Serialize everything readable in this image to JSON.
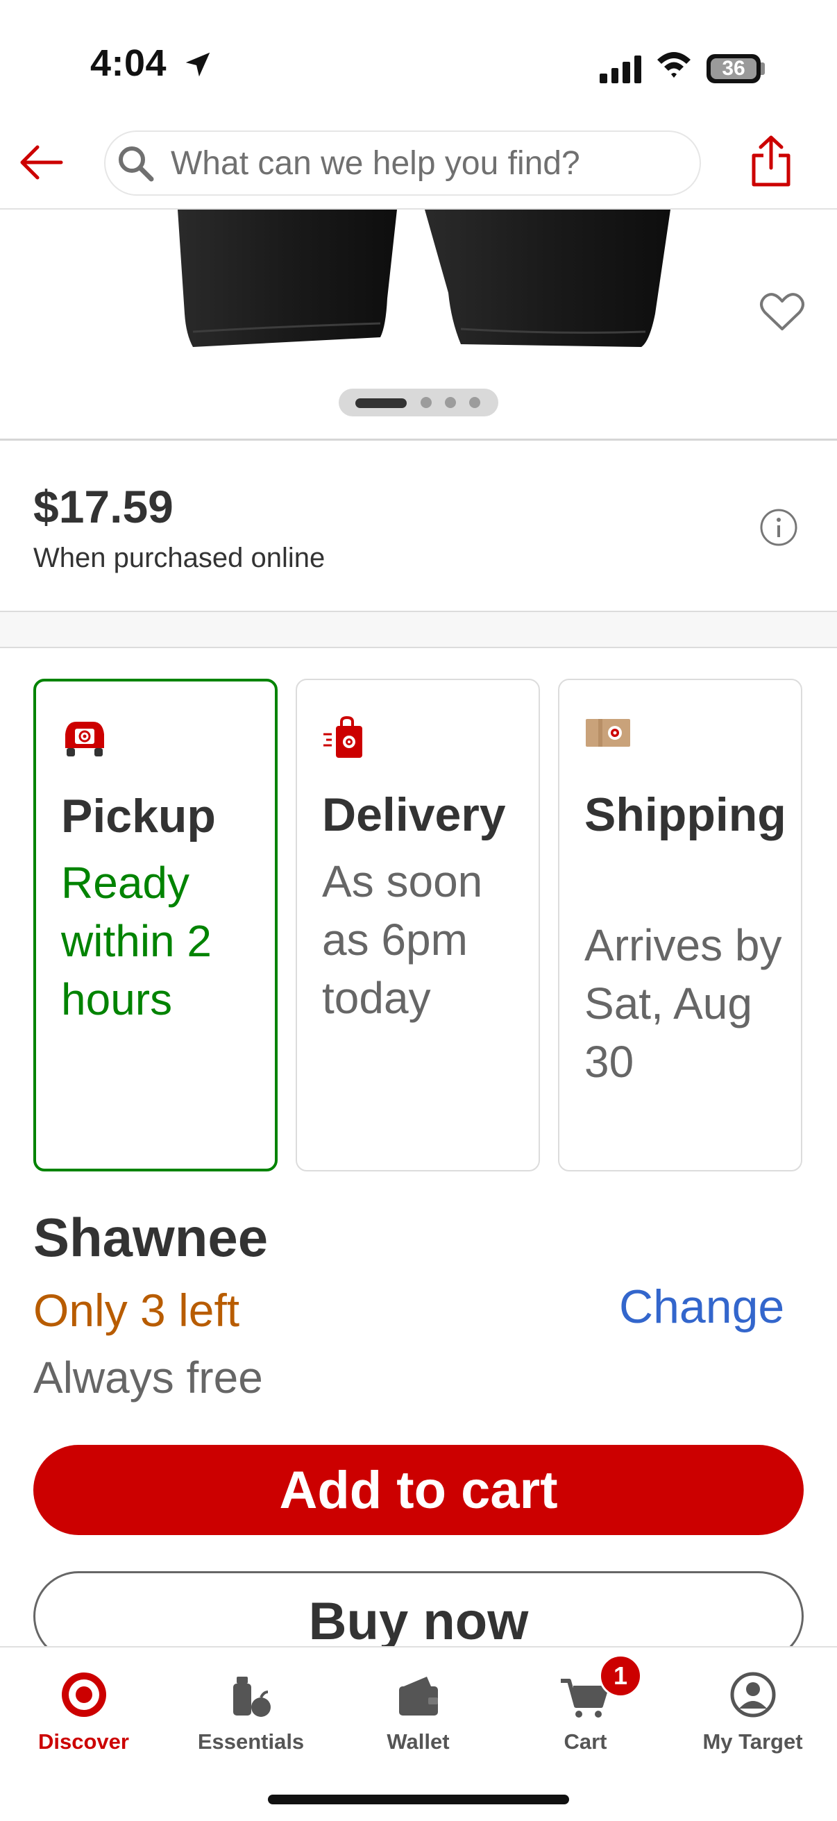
{
  "status_bar": {
    "time": "4:04",
    "battery": "36"
  },
  "header": {
    "search_placeholder": "What can we help you find?"
  },
  "price": {
    "amount": "$17.59",
    "note": "When purchased online"
  },
  "fulfillment": {
    "pickup": {
      "title": "Pickup",
      "detail": "Ready within 2 hours",
      "selected": true
    },
    "delivery": {
      "title": "Delivery",
      "detail": "As soon as 6pm today"
    },
    "shipping": {
      "title": "Shipping",
      "detail": "Arrives by Sat, Aug 30"
    }
  },
  "store": {
    "name": "Shawnee",
    "stock": "Only 3 left",
    "change_label": "Change",
    "pickup_cost": "Always free"
  },
  "actions": {
    "add_to_cart": "Add to cart",
    "buy_now": "Buy now"
  },
  "bottom_nav": {
    "items": [
      {
        "label": "Discover",
        "icon": "target-logo-icon",
        "active": true
      },
      {
        "label": "Essentials",
        "icon": "essentials-icon"
      },
      {
        "label": "Wallet",
        "icon": "wallet-icon"
      },
      {
        "label": "Cart",
        "icon": "cart-icon",
        "badge": "1"
      },
      {
        "label": "My Target",
        "icon": "account-icon"
      }
    ]
  },
  "colors": {
    "brand_red": "#cc0000",
    "pickup_green": "#008300",
    "link_blue": "#3366cc",
    "stock_orange": "#b85c00"
  }
}
